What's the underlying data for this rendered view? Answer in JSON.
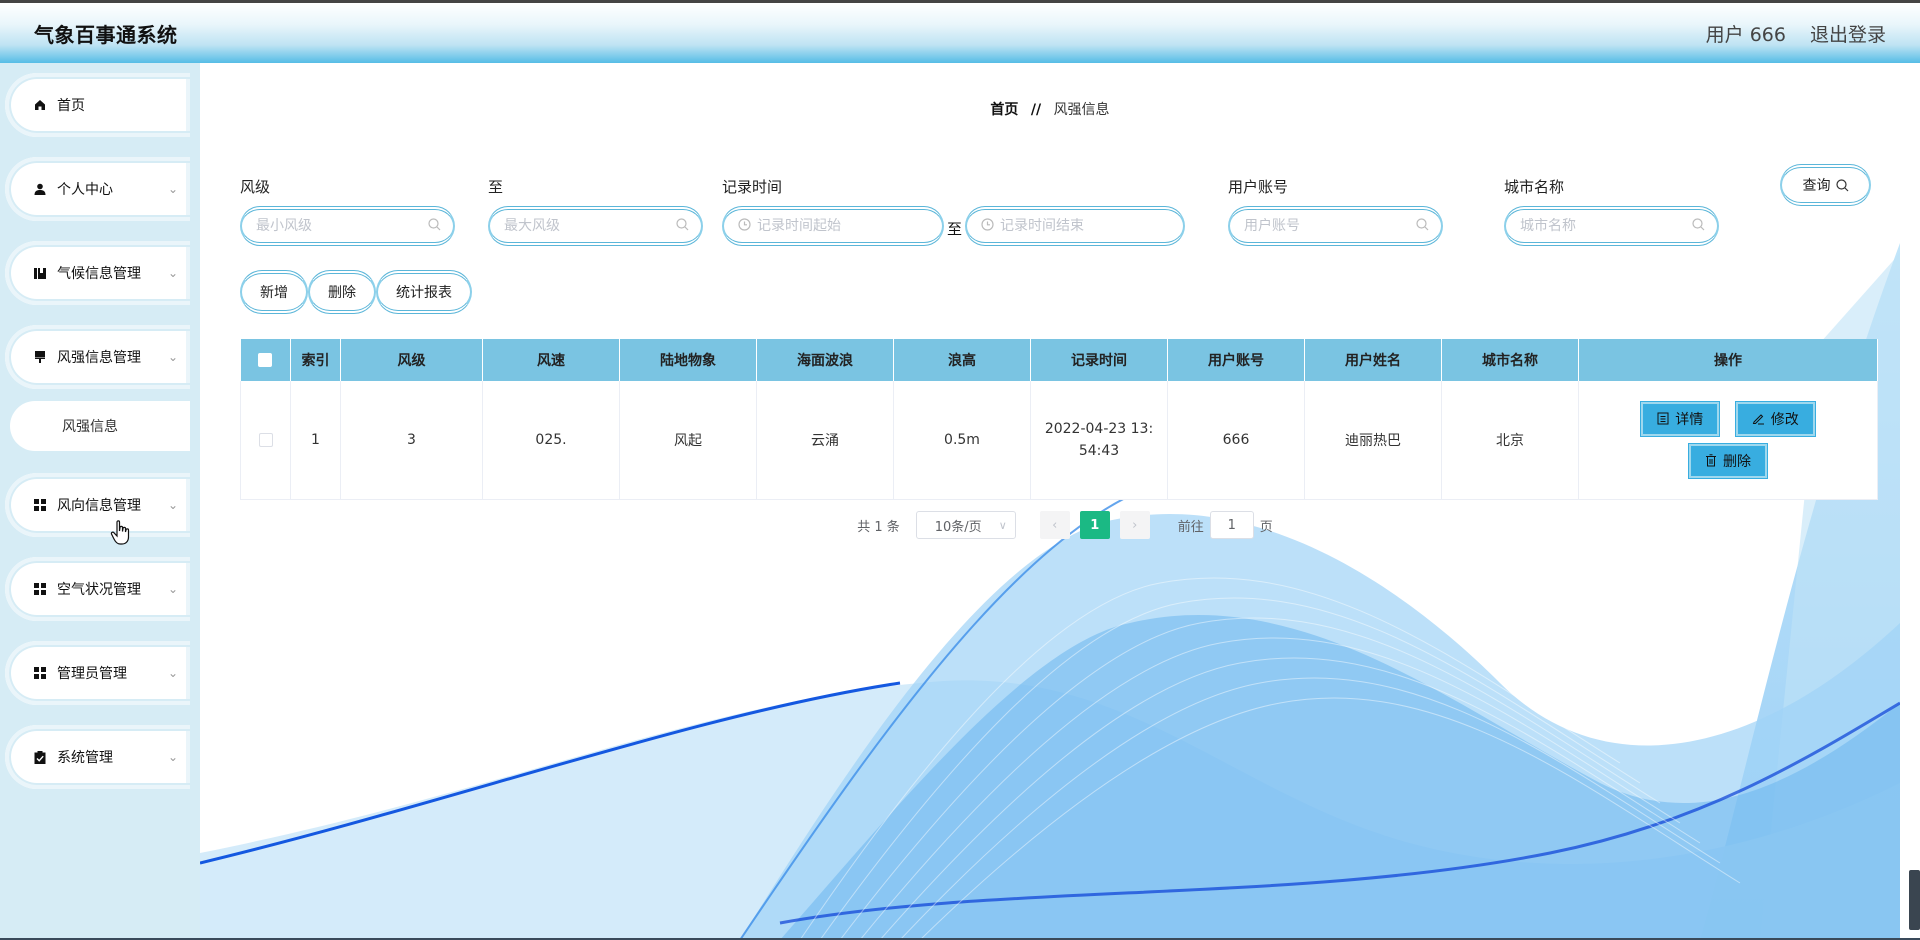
{
  "header": {
    "app_title": "气象百事通系统",
    "user_label": "用户 666",
    "logout_label": "退出登录"
  },
  "sidebar": {
    "items": [
      {
        "label": "首页",
        "icon": "home-icon",
        "glyph": "⌂",
        "has_children": false
      },
      {
        "label": "个人中心",
        "icon": "user-icon",
        "glyph": "●",
        "has_children": true
      },
      {
        "label": "气候信息管理",
        "icon": "chart-icon",
        "glyph": "▮",
        "has_children": true
      },
      {
        "label": "风强信息管理",
        "icon": "flag-icon",
        "glyph": "▼",
        "has_children": true,
        "expanded": true,
        "children": [
          {
            "label": "风强信息"
          }
        ]
      },
      {
        "label": "风向信息管理",
        "icon": "grid-icon",
        "glyph": "▦",
        "has_children": true
      },
      {
        "label": "空气状况管理",
        "icon": "grid-icon",
        "glyph": "▦",
        "has_children": true
      },
      {
        "label": "管理员管理",
        "icon": "grid-icon",
        "glyph": "▦",
        "has_children": true
      },
      {
        "label": "系统管理",
        "icon": "clipboard-icon",
        "glyph": "☑",
        "has_children": true
      }
    ],
    "chevron": "⌄"
  },
  "breadcrumb": {
    "home": "首页",
    "separator": "//",
    "current": "风强信息"
  },
  "search": {
    "fields": [
      {
        "label": "风级",
        "placeholder": "最小风级",
        "value": ""
      },
      {
        "label": "至",
        "placeholder": "最大风级",
        "value": ""
      },
      {
        "label": "记录时间",
        "placeholder": "记录时间起始",
        "value": ""
      },
      {
        "label": "",
        "placeholder": "记录时间结束",
        "value": ""
      },
      {
        "label": "用户账号",
        "placeholder": "用户账号",
        "value": ""
      },
      {
        "label": "城市名称",
        "placeholder": "城市名称",
        "value": ""
      }
    ],
    "range_separator": "至",
    "query_label": "查询"
  },
  "actions": {
    "add_label": "新增",
    "delete_label": "删除",
    "report_label": "统计报表"
  },
  "table": {
    "columns": [
      "索引",
      "风级",
      "风速",
      "陆地物象",
      "海面波浪",
      "浪高",
      "记录时间",
      "用户账号",
      "用户姓名",
      "城市名称",
      "操作"
    ],
    "rows": [
      {
        "index": "1",
        "wind_level": "3",
        "wind_speed": "025.",
        "land_phenomenon": "风起",
        "sea_wave": "云涌",
        "wave_height": "0.5m",
        "record_time": "2022-04-23 13:54:43",
        "user_account": "666",
        "user_name": "迪丽热巴",
        "city_name": "北京"
      }
    ],
    "row_actions": {
      "detail_label": "详情",
      "edit_label": "修改",
      "delete_label": "删除"
    }
  },
  "pagination": {
    "total_text": "共 1 条",
    "page_size": "10条/页",
    "current_page": "1",
    "goto_label": "前往",
    "goto_value": "1",
    "page_suffix": "页"
  },
  "colors": {
    "header_accent": "#56bde6",
    "table_header": "#7ac4e2",
    "action_button": "#38ade0",
    "active_page": "#1bb984",
    "sidebar_bg": "#d6ecf5"
  }
}
